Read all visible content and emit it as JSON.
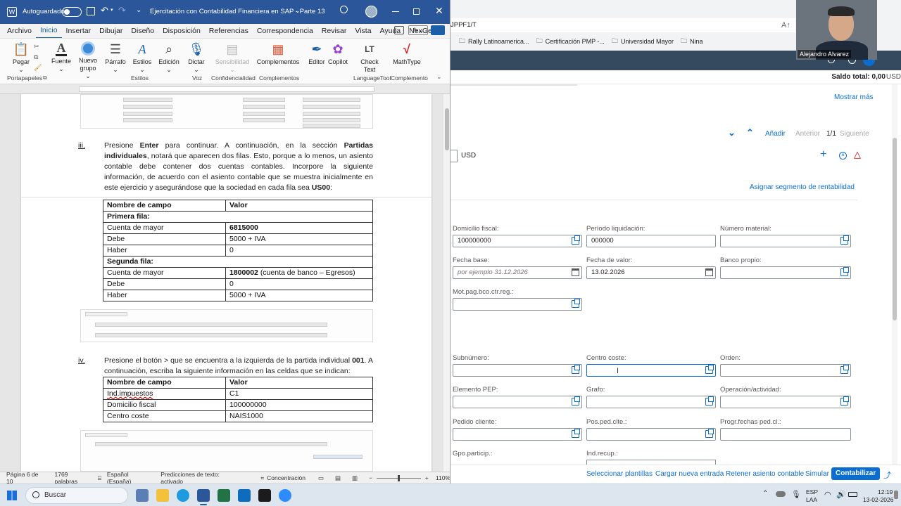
{
  "word": {
    "titlebar": {
      "autosave_label": "Autoguardado",
      "title": "Ejercitación con Contabilidad Financiera en SAP - Parte 13",
      "avatar": "👤"
    },
    "tabs": [
      "Archivo",
      "Inicio",
      "Insertar",
      "Dibujar",
      "Diseño",
      "Disposición",
      "Referencias",
      "Correspondencia",
      "Revisar",
      "Vista",
      "Ayuda",
      "NexGen"
    ],
    "ribbon": {
      "buttons": {
        "pegar": "Pegar",
        "fuente": "Fuente",
        "nuevo_grupo": "Nuevo grupo",
        "parrafo": "Párrafo",
        "estilos": "Estilos",
        "edicion": "Edición",
        "dictar": "Dictar",
        "sensibilidad": "Sensibilidad",
        "complementos": "Complementos",
        "editor": "Editor",
        "copilot": "Copilot",
        "check_text": "Check Text",
        "mathtype": "MathType"
      },
      "groups": {
        "portapapeles": "Portapapeles",
        "estilos": "Estilos",
        "voz": "Voz",
        "confidencialidad": "Confidencialidad",
        "complementos": "Complementos",
        "languagetool": "LanguageTool",
        "complemento": "Complemento"
      }
    },
    "doc": {
      "step_iii_marker": "iii.",
      "step_iii_text_1": "Presione ",
      "step_iii_bold_enter": "Enter",
      "step_iii_text_2": " para continuar. A continuación, en la sección ",
      "step_iii_bold_partidas": "Partidas individuales",
      "step_iii_text_3": ", notará que aparecen dos filas. Esto, porque a lo menos, un asiento contable debe contener dos cuentas contables. Incorpore la siguiente información, de acuerdo con el asiento contable que se muestra inicialmente en este ejercicio y asegurándose que la sociedad en cada fila sea ",
      "step_iii_bold_us00": "US00",
      "step_iii_text_4": ":",
      "table1": {
        "header": [
          "Nombre de campo",
          "Valor"
        ],
        "section1": "Primera fila:",
        "rows1": [
          [
            "Cuenta de mayor",
            "6815000"
          ],
          [
            "Debe",
            "5000 + IVA"
          ],
          [
            "Haber",
            "0"
          ]
        ],
        "section2": "Segunda fila:",
        "rows2": [
          [
            "Cuenta de mayor",
            "1800002",
            "(cuenta de banco – Egresos)"
          ],
          [
            "Debe",
            "0"
          ],
          [
            "Haber",
            "5000 + IVA"
          ]
        ]
      },
      "step_iv_marker": "iv.",
      "step_iv_text_1": "Presione el botón > que se encuentra a la izquierda de la partida individual ",
      "step_iv_bold_001": "001",
      "step_iv_text_2": ". A continuación, escriba la siguiente información en las celdas que se indican:",
      "table2": {
        "header": [
          "Nombre de campo",
          "Valor"
        ],
        "rows": [
          [
            "Ind.impuestos",
            "C1"
          ],
          [
            "Domicilio fiscal",
            "100000000"
          ],
          [
            "Centro coste",
            "NAIS1000"
          ]
        ]
      }
    },
    "status": {
      "page": "Página 6 de 10",
      "words": "1769 palabras",
      "language": "Español (España)",
      "predictions": "Predicciones de texto: activado",
      "focus": "Concentración",
      "zoom": "110%"
    }
  },
  "browser": {
    "url": "JPPF1/T",
    "bookmarks": [
      "Rally Latinoamerica...",
      "Certificación PMP -...",
      "Universidad Mayor",
      "Nina"
    ]
  },
  "sap": {
    "saldo_total": "Saldo total: 0,00",
    "saldo_currency": "USD",
    "mostrar_mas": "Mostrar más",
    "nav": {
      "anadir": "Añadir",
      "anterior": "Anterior",
      "page": "1/1",
      "siguiente": "Siguiente"
    },
    "currency": "USD",
    "asignar": "Asignar segmento de rentabilidad",
    "fields": {
      "domicilio_fiscal": {
        "label": "Domicilio fiscal:",
        "value": "100000000"
      },
      "periodo_liquidacion": {
        "label": "Período liquidación:",
        "value": "000000"
      },
      "numero_material": {
        "label": "Número material:",
        "value": ""
      },
      "fecha_base": {
        "label": "Fecha base:",
        "placeholder": "por ejemplo 31.12.2026"
      },
      "fecha_valor": {
        "label": "Fecha de valor:",
        "value": "13.02.2026"
      },
      "banco_propio": {
        "label": "Banco propio:",
        "value": ""
      },
      "mot_pag": {
        "label": "Mot.pag.bco.ctr.reg.:",
        "value": ""
      },
      "subnumero": {
        "label": "Subnúmero:",
        "value": ""
      },
      "centro_coste": {
        "label": "Centro coste:",
        "value": ""
      },
      "orden": {
        "label": "Orden:",
        "value": ""
      },
      "elemento_pep": {
        "label": "Elemento PEP:",
        "value": ""
      },
      "grafo": {
        "label": "Grafo:",
        "value": ""
      },
      "operacion": {
        "label": "Operación/actividad:",
        "value": ""
      },
      "pedido_cliente": {
        "label": "Pedido cliente:",
        "value": ""
      },
      "pos_ped": {
        "label": "Pos.ped.clte.:",
        "value": ""
      },
      "progr_fechas": {
        "label": "Progr.fechas ped.cl.:",
        "value": ""
      },
      "gpo_particip": {
        "label": "Gpo.particip.:"
      },
      "ind_recup": {
        "label": "Ind.recup.:"
      }
    },
    "footer": {
      "seleccionar": "Seleccionar plantillas",
      "cargar": "Cargar nueva entrada",
      "retener": "Retener asiento contable",
      "simular": "Simular",
      "contabilizar": "Contabilizar"
    }
  },
  "webcam": {
    "name": "Alejandro Alvarez"
  },
  "taskbar": {
    "search": "Buscar",
    "lang_1": "ESP",
    "lang_2": "LAA",
    "time": "12:19",
    "date": "13-02-2026"
  },
  "colors": {
    "word_blue": "#2b579a",
    "sap_blue": "#0a6ed1",
    "sap_shell": "#354a5f",
    "error_red": "#bb0000"
  }
}
